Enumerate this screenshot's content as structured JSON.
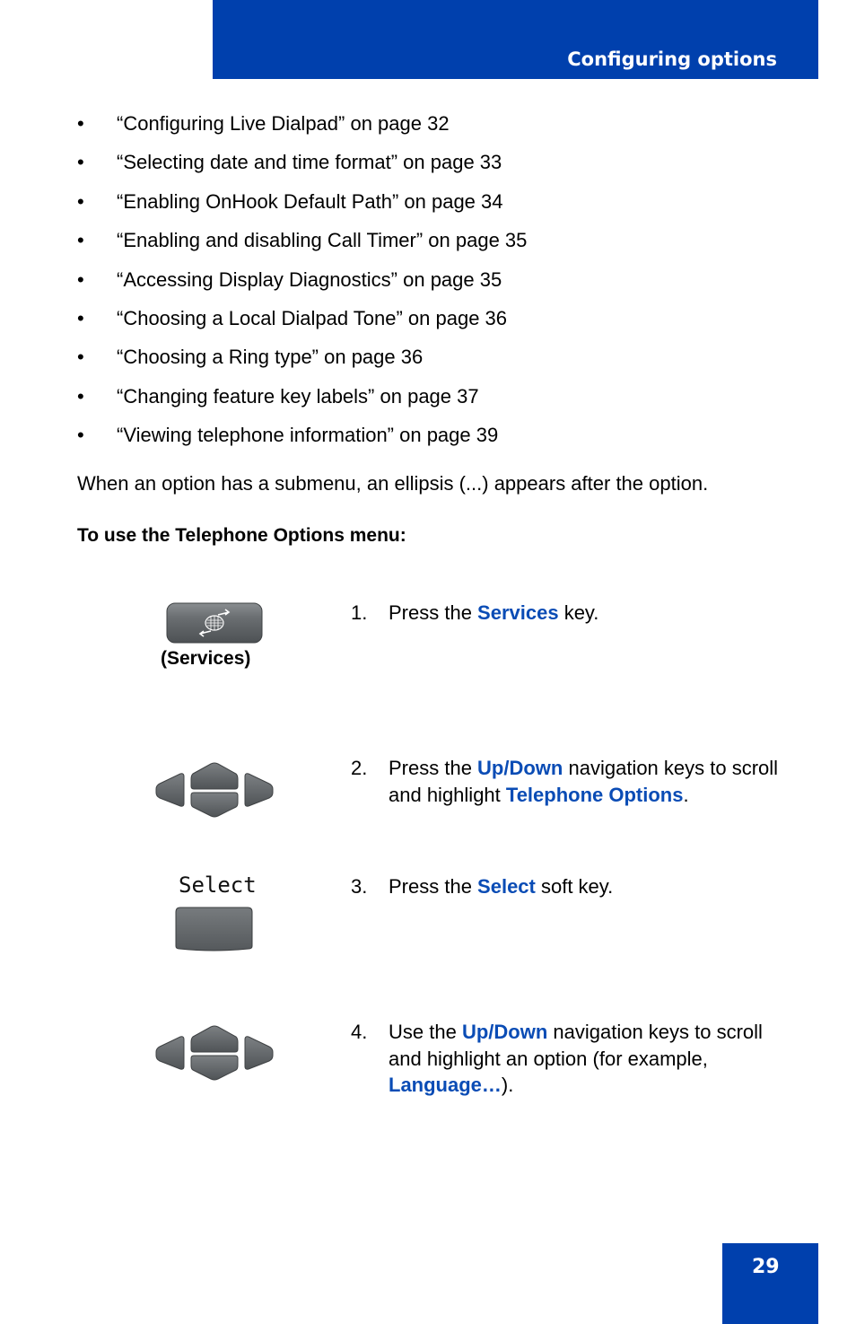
{
  "header": {
    "section_title": "Configuring options"
  },
  "bullets": [
    "“Configuring Live Dialpad” on page 32",
    "“Selecting date and time format” on page 33",
    "“Enabling OnHook Default Path” on page 34",
    "“Enabling and disabling Call Timer” on page 35",
    "“Accessing Display Diagnostics” on page 35",
    "“Choosing a Local Dialpad Tone” on page 36",
    "“Choosing a Ring type” on page 36",
    "“Changing feature key labels” on page 37",
    "“Viewing telephone information” on page 39"
  ],
  "bullet_glyph": "•",
  "paragraph": "When an option has a submenu, an ellipsis (...) appears after the option.",
  "procedure_title": "To use the Telephone Options menu:",
  "icons": {
    "services_key": "services-key-icon",
    "services_label": "(Services)",
    "nav_keys": "navigation-cluster-icon",
    "select_softkey_label": "Select",
    "select_softkey": "soft-key-icon"
  },
  "steps": [
    {
      "num": "1.",
      "parts": [
        "Press the ",
        "Services",
        " key."
      ]
    },
    {
      "num": "2.",
      "parts": [
        "Press the ",
        "Up/Down",
        " navigation keys to scroll and highlight ",
        "Telephone Options",
        "."
      ]
    },
    {
      "num": "3.",
      "parts": [
        "Press the ",
        "Select",
        " soft key."
      ]
    },
    {
      "num": "4.",
      "parts": [
        "Use the ",
        "Up/Down",
        " navigation keys to scroll and highlight an option (for example, ",
        "Language…",
        ")."
      ]
    }
  ],
  "footer": {
    "page_number": "29"
  },
  "colors": {
    "brand_blue": "#0040ad",
    "highlight_blue": "#0a4cb5",
    "key_gray": "#5f6366"
  }
}
